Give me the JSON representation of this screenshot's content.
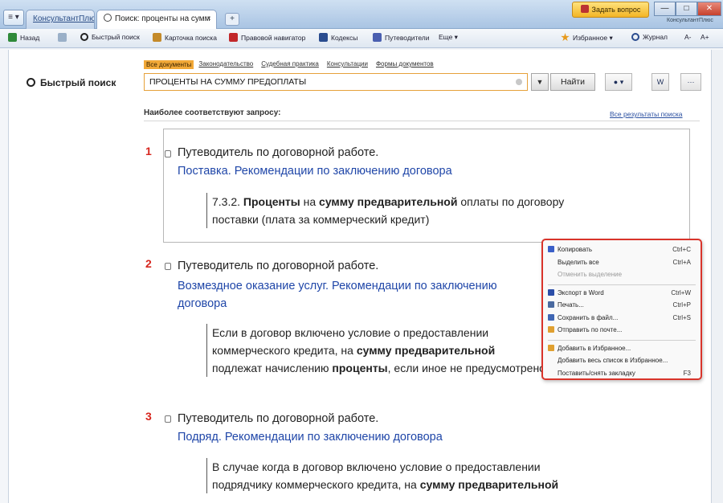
{
  "tabbar": {
    "menu_label": "≡ ▾",
    "tabs": [
      {
        "label": "КонсультантПлюс",
        "active": false
      },
      {
        "label": "Поиск: проценты на сумм",
        "active": true
      }
    ],
    "close_glyph": "×",
    "new_tab_glyph": "+",
    "ask_button": "Задать вопрос",
    "window_buttons": [
      "—",
      "□",
      "✕"
    ],
    "brand_small": "КонсультантПлюс"
  },
  "toolbar": {
    "items": [
      {
        "label": "Назад",
        "icon": "back-arrow-icon"
      },
      {
        "label": "",
        "icon": "forward-arrow-icon"
      },
      {
        "label": "Быстрый поиск",
        "icon": "search-icon"
      },
      {
        "label": "Карточка поиска",
        "icon": "search-card-icon"
      },
      {
        "label": "Правовой навигатор",
        "icon": "navigator-icon"
      },
      {
        "label": "Кодексы",
        "icon": "codes-icon"
      },
      {
        "label": "Путеводители",
        "icon": "guides-icon"
      },
      {
        "label": "Еще ▾",
        "icon": ""
      },
      {
        "label": "Избранное ▾",
        "icon": "star-icon"
      },
      {
        "label": "Журнал",
        "icon": "history-icon"
      },
      {
        "label": "A-",
        "icon": ""
      },
      {
        "label": "A+",
        "icon": ""
      }
    ]
  },
  "search": {
    "section_label": "Быстрый поиск",
    "filters": [
      "Все документы",
      "Законодательство",
      "Судебная практика",
      "Консультации",
      "Формы документов"
    ],
    "active_filter_index": 0,
    "query": "ПРОЦЕНТЫ НА СУММУ ПРЕДОПЛАТЫ",
    "dropdown_glyph": "▼",
    "find_button": "Найти",
    "right_buttons": [
      "● ▾",
      "W",
      "···"
    ]
  },
  "results_header": {
    "most_relevant": "Наиболее соответствуют запросу:",
    "all_results_link": "Все результаты поиска"
  },
  "results": [
    {
      "number": "1",
      "title": "Путеводитель по договорной работе.",
      "link_lines": [
        "Поставка. Рекомендации по заключению договора"
      ],
      "snippet_lines": [
        [
          {
            "t": "7.3.2. ",
            "b": false
          },
          {
            "t": "Проценты",
            "b": true
          },
          {
            "t": " на ",
            "b": false
          },
          {
            "t": "сумму предварительной",
            "b": true
          },
          {
            "t": " оплаты по договору",
            "b": false
          }
        ],
        [
          {
            "t": "поставки (плата за коммерческий кредит)",
            "b": false
          }
        ]
      ]
    },
    {
      "number": "2",
      "title": "Путеводитель по договорной работе.",
      "link_lines": [
        "Возмездное оказание услуг. Рекомендации по заключению",
        "договора"
      ],
      "snippet_lines": [
        [
          {
            "t": "Если в договор включено условие о предоставлении",
            "b": false
          }
        ],
        [
          {
            "t": "коммерческого кредита, на ",
            "b": false
          },
          {
            "t": "сумму предварительной",
            "b": true
          }
        ],
        [
          {
            "t": "подлежат начислению ",
            "b": false
          },
          {
            "t": "проценты",
            "b": true
          },
          {
            "t": ", если иное не предусмотрено",
            "b": false
          }
        ]
      ]
    },
    {
      "number": "3",
      "title": "Путеводитель по договорной работе.",
      "link_lines": [
        "Подряд. Рекомендации по заключению договора"
      ],
      "snippet_lines": [
        [
          {
            "t": "В случае когда в договор включено условие о предоставлении",
            "b": false
          }
        ],
        [
          {
            "t": "подрядчику коммерческого кредита, на ",
            "b": false
          },
          {
            "t": "сумму предварительной",
            "b": true
          }
        ]
      ]
    }
  ],
  "context_menu": {
    "items": [
      {
        "label": "Копировать",
        "shortcut": "Ctrl+C",
        "icon": "copy-icon",
        "color": "#3a5fc8",
        "disabled": false
      },
      {
        "label": "Выделить все",
        "shortcut": "Ctrl+A",
        "icon": "",
        "color": "",
        "disabled": false
      },
      {
        "label": "Отменить выделение",
        "shortcut": "",
        "icon": "",
        "color": "",
        "disabled": true
      },
      {
        "sep": true
      },
      {
        "label": "Экспорт в Word",
        "shortcut": "Ctrl+W",
        "icon": "word-icon",
        "color": "#2b4ea8",
        "disabled": false
      },
      {
        "label": "Печать...",
        "shortcut": "Ctrl+P",
        "icon": "print-icon",
        "color": "#4a6aa0",
        "disabled": false
      },
      {
        "label": "Сохранить в файл...",
        "shortcut": "Ctrl+S",
        "icon": "save-icon",
        "color": "#3f66b3",
        "disabled": false
      },
      {
        "label": "Отправить по почте...",
        "shortcut": "",
        "icon": "mail-icon",
        "color": "#e0a030",
        "disabled": false
      },
      {
        "sep": true
      },
      {
        "label": "Добавить в Избранное...",
        "shortcut": "",
        "icon": "favorite-icon",
        "color": "#e0a030",
        "disabled": false
      },
      {
        "label": "Добавить весь список в Избранное...",
        "shortcut": "",
        "icon": "",
        "color": "",
        "disabled": false
      },
      {
        "label": "Поставить/снять закладку",
        "shortcut": "F3",
        "icon": "",
        "color": "",
        "disabled": false
      }
    ]
  },
  "colors": {
    "accent_orange": "#f2a938",
    "link_blue": "#1f46a8",
    "result_number_red": "#d7261e",
    "menu_border_red": "#d9342b"
  }
}
